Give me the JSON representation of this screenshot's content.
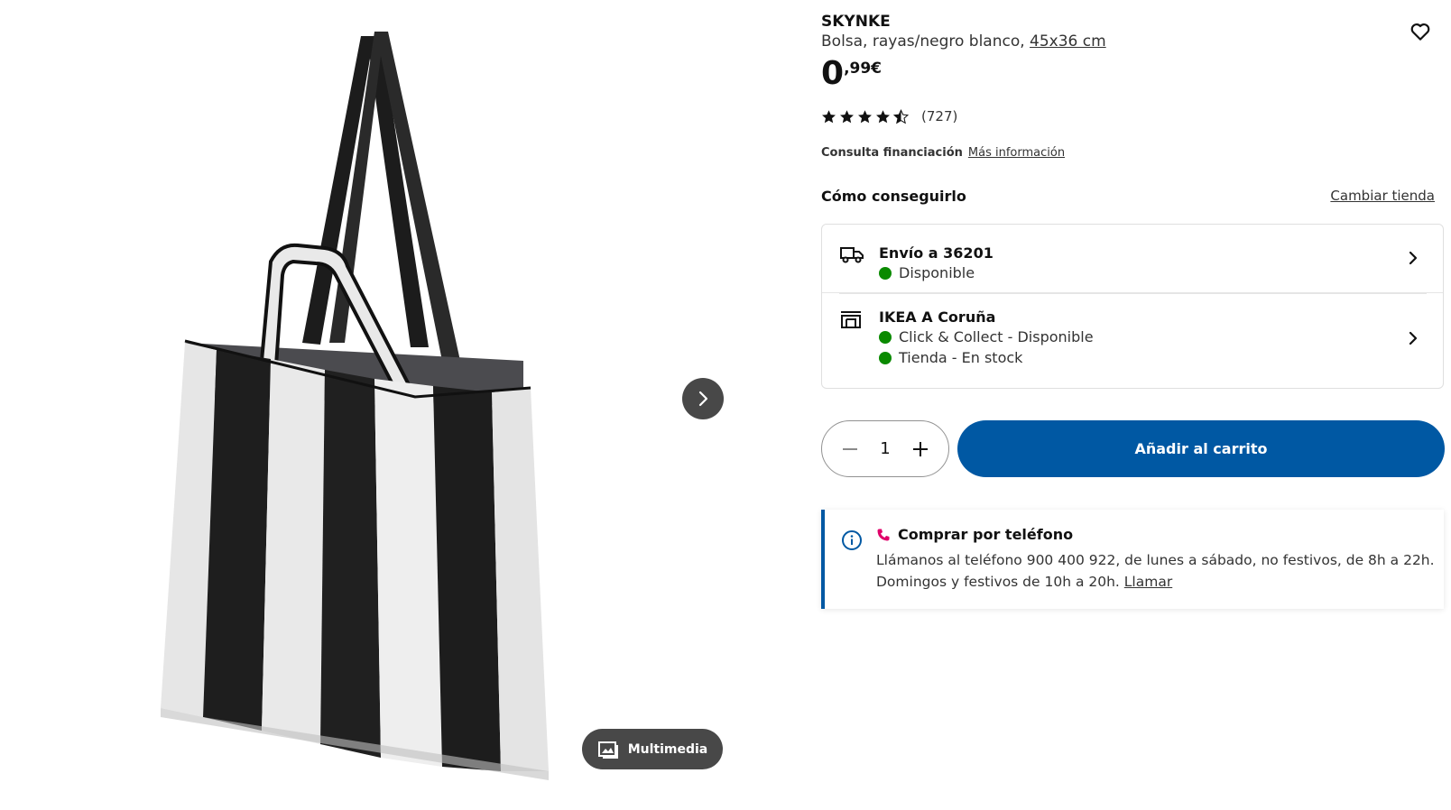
{
  "product": {
    "name": "SKYNKE",
    "description": "Bolsa, rayas/negro blanco, ",
    "size": "45x36 cm",
    "price_int": "0",
    "price_dec": ",99€",
    "rating": 4.5,
    "rating_count": "(727)"
  },
  "media": {
    "multimedia_label": "Multimedia"
  },
  "financing": {
    "label": "Consulta financiación",
    "more": "Más información"
  },
  "availability": {
    "title": "Cómo conseguirlo",
    "change_store": "Cambiar tienda",
    "delivery": {
      "title": "Envío a 36201",
      "status": "Disponible"
    },
    "store": {
      "title": "IKEA A Coruña",
      "status_1": "Click & Collect - Disponible",
      "status_2": "Tienda - En stock"
    },
    "status_color": "#0a8a00"
  },
  "cart": {
    "quantity": "1",
    "add_label": "Añadir al carrito",
    "accent": "#0058a3"
  },
  "phone": {
    "title": "Comprar por teléfono",
    "text": "Llámanos al teléfono 900 400 922, de lunes a sábado, no festivos, de 8h a 22h. Domingos y festivos de 10h a 20h. ",
    "link": "Llamar"
  }
}
